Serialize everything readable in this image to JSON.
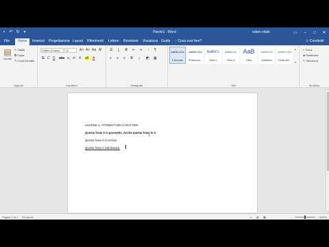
{
  "window": {
    "title": "Parole1 - Word",
    "user": "ruben vitale",
    "controls": [
      "restore-icon",
      "minimize-icon",
      "maximize-icon",
      "close-icon"
    ]
  },
  "tabs": {
    "items": [
      "File",
      "Home",
      "Inserisci",
      "Progettazione",
      "Layout",
      "Riferimenti",
      "Lettere",
      "Revisione",
      "Visualizza",
      "Guida"
    ],
    "active": "Home",
    "tell_me": "Cosa vuoi fare?",
    "share": "Condividi"
  },
  "ribbon": {
    "clipboard": {
      "paste": "Incolla",
      "cut": "Taglia",
      "copy": "Copia",
      "format_painter": "Copia formato",
      "group": "Appunti"
    },
    "font": {
      "name": "Calibri (Corpo)",
      "size": "11",
      "group": "Carattere"
    },
    "paragraph": {
      "group": "Paragrafo"
    },
    "styles": {
      "items": [
        {
          "sample": "AaBbCcDc",
          "name": "¶ Normale"
        },
        {
          "sample": "AaBbCcDc",
          "name": "¶ Nessuna..."
        },
        {
          "sample": "AaBbCc",
          "name": "Titolo 1"
        },
        {
          "sample": "AaBbCcC",
          "name": "Titolo 2"
        },
        {
          "sample": "AaB",
          "name": "Titolo"
        },
        {
          "sample": "AaBbCcD",
          "name": "Sottotitolo"
        },
        {
          "sample": "AaBbCcDa",
          "name": "Enfasi deli..."
        }
      ],
      "group": "Stili"
    },
    "editing": {
      "find": "Trova",
      "replace": "Sostituisci",
      "select": "Seleziona",
      "group": "Modifica"
    }
  },
  "document": {
    "lines": [
      "LEZIONE 1: ATTRIBUTI DEI CARATTERI",
      "Questa frase è in grassetto. Anche questa frase lo è.",
      "Questa frase è in corsivo",
      "Questa frase è sottolineata."
    ]
  },
  "status": {
    "page": "Pagina 1 di 1",
    "words": "24 parole",
    "zoom": "+100%"
  },
  "colors": {
    "title_bar": "#2b579a",
    "ribbon": "#f3f3f3",
    "workspace": "#e6e6e6"
  }
}
